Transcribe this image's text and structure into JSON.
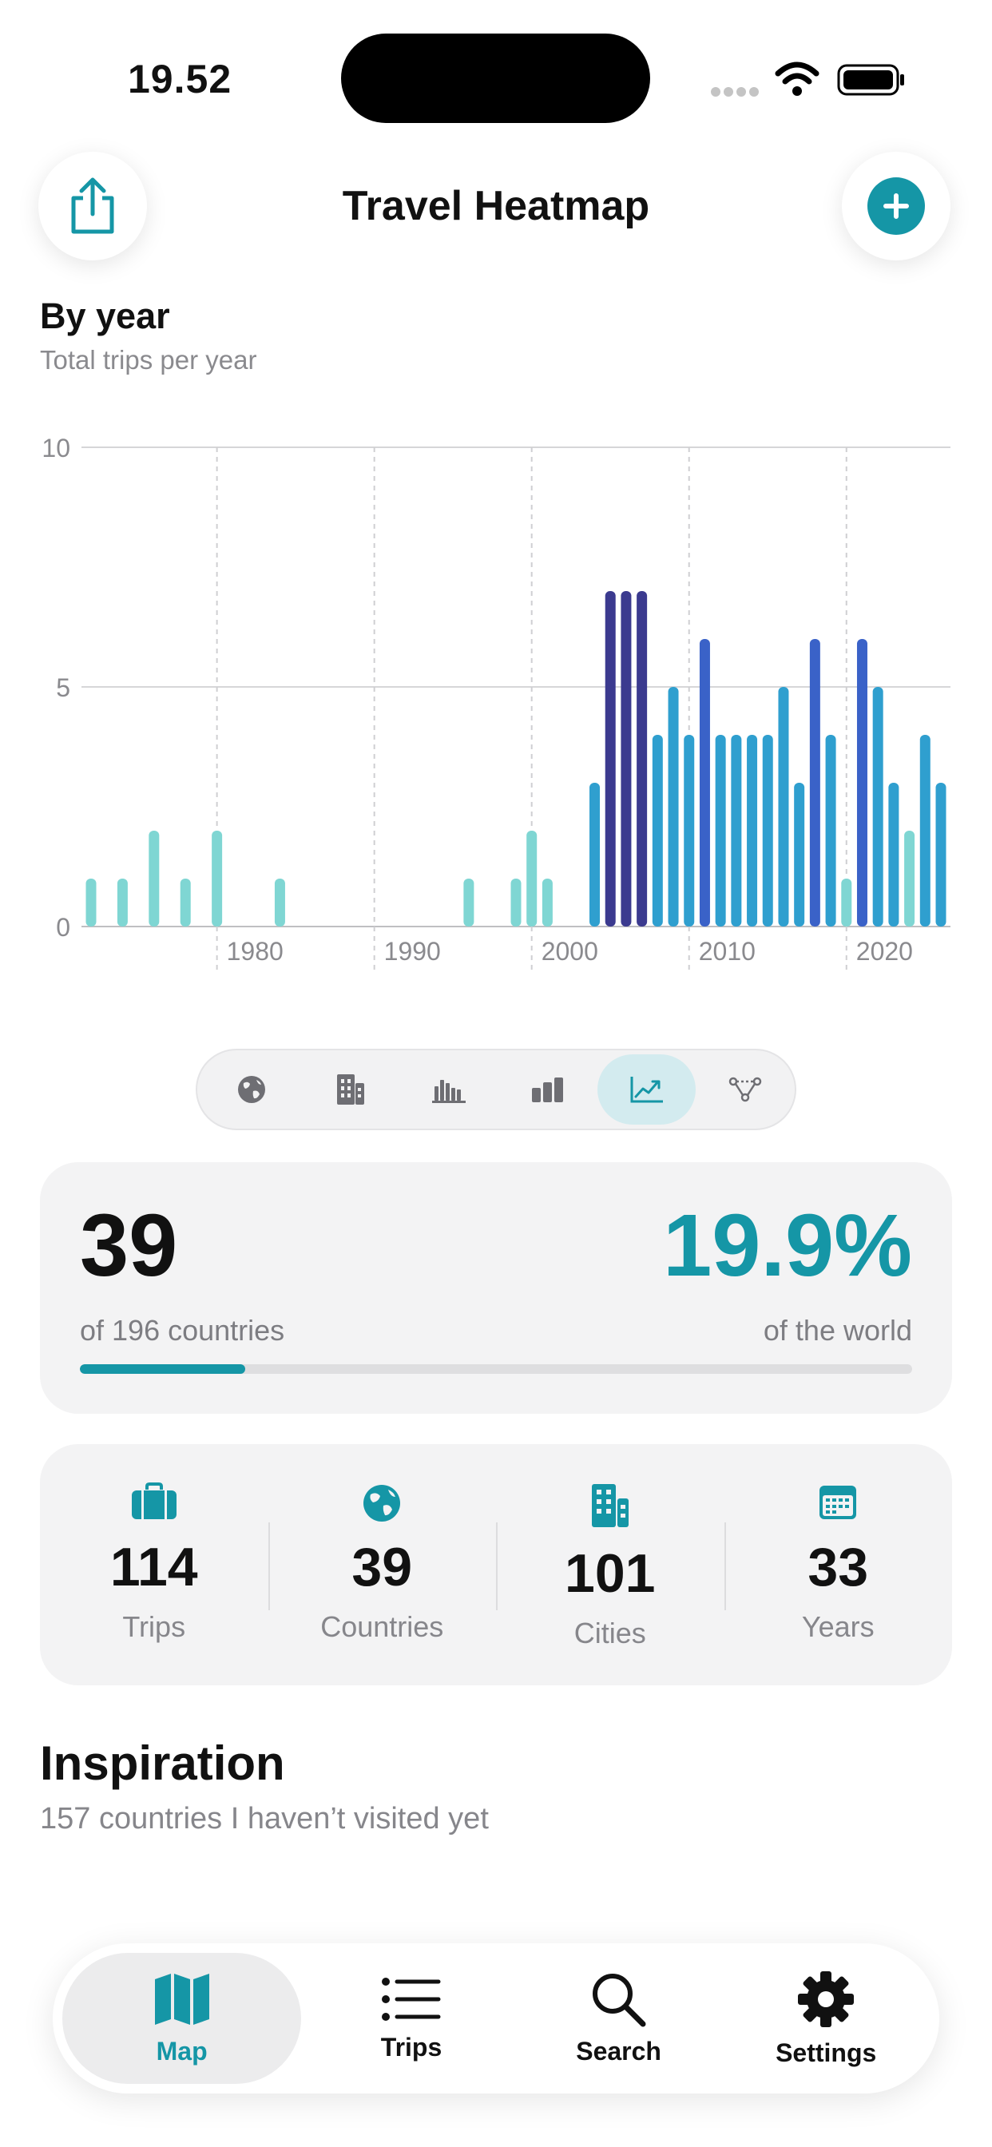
{
  "status_bar": {
    "time": "19.52"
  },
  "header": {
    "title": "Travel Heatmap",
    "share_icon": "share-icon",
    "add_icon": "plus-icon"
  },
  "section": {
    "title": "By year",
    "subtitle": "Total trips per year"
  },
  "chart_data": {
    "type": "bar",
    "title": "By year",
    "subtitle": "Total trips per year",
    "x_range": [
      1970,
      2024
    ],
    "x_ticks": [
      "1980",
      "1990",
      "2000",
      "2010",
      "2020"
    ],
    "y_ticks": [
      "0",
      "5",
      "10"
    ],
    "ylim": [
      0,
      10
    ],
    "grid": true,
    "color_scale": [
      "#7fd6d3",
      "#2f9fcf",
      "#3a62c8",
      "#3b3a8f"
    ],
    "points": [
      {
        "year": 1970,
        "value": 1
      },
      {
        "year": 1972,
        "value": 1
      },
      {
        "year": 1974,
        "value": 2
      },
      {
        "year": 1976,
        "value": 1
      },
      {
        "year": 1978,
        "value": 2
      },
      {
        "year": 1982,
        "value": 1
      },
      {
        "year": 1994,
        "value": 1
      },
      {
        "year": 1997,
        "value": 1
      },
      {
        "year": 1998,
        "value": 2
      },
      {
        "year": 1999,
        "value": 1
      },
      {
        "year": 2002,
        "value": 3
      },
      {
        "year": 2003,
        "value": 7
      },
      {
        "year": 2004,
        "value": 7
      },
      {
        "year": 2005,
        "value": 7
      },
      {
        "year": 2006,
        "value": 4
      },
      {
        "year": 2007,
        "value": 5
      },
      {
        "year": 2008,
        "value": 4
      },
      {
        "year": 2009,
        "value": 6
      },
      {
        "year": 2010,
        "value": 4
      },
      {
        "year": 2011,
        "value": 4
      },
      {
        "year": 2012,
        "value": 4
      },
      {
        "year": 2013,
        "value": 4
      },
      {
        "year": 2014,
        "value": 5
      },
      {
        "year": 2015,
        "value": 3
      },
      {
        "year": 2016,
        "value": 6
      },
      {
        "year": 2017,
        "value": 4
      },
      {
        "year": 2018,
        "value": 1
      },
      {
        "year": 2019,
        "value": 6
      },
      {
        "year": 2020,
        "value": 5
      },
      {
        "year": 2021,
        "value": 3
      },
      {
        "year": 2022,
        "value": 2
      },
      {
        "year": 2023,
        "value": 4
      },
      {
        "year": 2024,
        "value": 3
      }
    ]
  },
  "segments": [
    {
      "icon": "globe-icon",
      "active": false
    },
    {
      "icon": "building-icon",
      "active": false
    },
    {
      "icon": "bar-chart-icon",
      "active": false
    },
    {
      "icon": "column-chart-icon",
      "active": false
    },
    {
      "icon": "line-chart-icon",
      "active": true
    },
    {
      "icon": "network-icon",
      "active": false
    }
  ],
  "world": {
    "count": "39",
    "count_label": "of 196 countries",
    "percent": "19.9%",
    "percent_label": "of the world",
    "progress": 0.199
  },
  "stats": [
    {
      "icon": "suitcase-icon",
      "value": "114",
      "label": "Trips"
    },
    {
      "icon": "globe-icon",
      "value": "39",
      "label": "Countries"
    },
    {
      "icon": "building-icon",
      "value": "101",
      "label": "Cities"
    },
    {
      "icon": "calendar-icon",
      "value": "33",
      "label": "Years"
    }
  ],
  "inspiration": {
    "title": "Inspiration",
    "subtitle": "157 countries I haven’t visited yet"
  },
  "tabs": [
    {
      "label": "Map",
      "icon": "map-icon",
      "active": true
    },
    {
      "label": "Trips",
      "icon": "list-icon",
      "active": false
    },
    {
      "label": "Search",
      "icon": "search-icon",
      "active": false
    },
    {
      "label": "Settings",
      "icon": "gear-icon",
      "active": false
    }
  ],
  "colors": {
    "accent": "#1596a6",
    "text": "#111111",
    "secondary": "#86868b"
  }
}
